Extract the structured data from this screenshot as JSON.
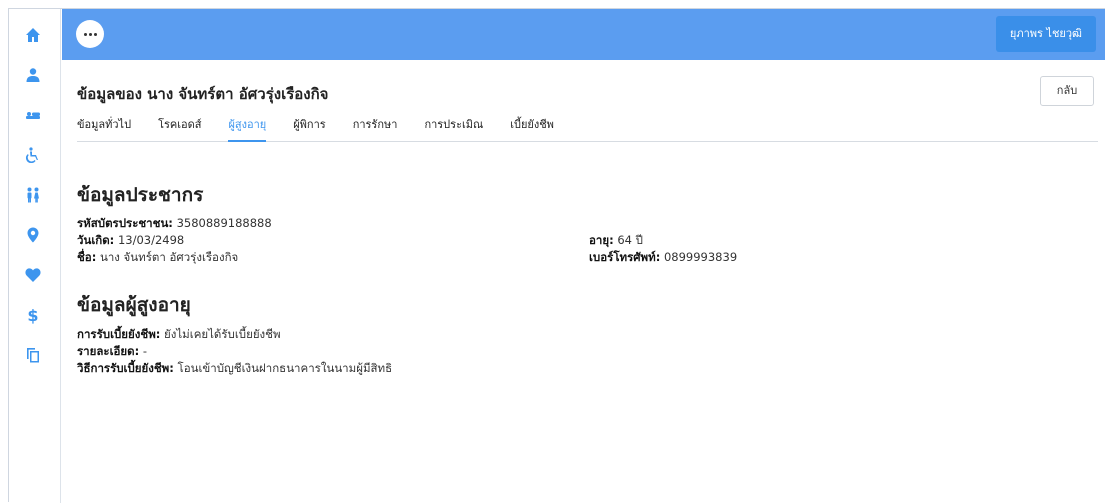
{
  "topbar": {
    "user_label": "ยุภาพร ไชยวุฒิ"
  },
  "sidebar": {
    "icons": [
      "home-icon",
      "person-icon",
      "bed-icon",
      "wheelchair-icon",
      "family-icon",
      "location-icon",
      "heart-icon",
      "dollar-icon",
      "copy-icon"
    ],
    "dollar_glyph": "$"
  },
  "header": {
    "title": "ข้อมูลของ นาง จันทร์ตา อัศวรุ่งเรืองกิจ",
    "back_label": "กลับ"
  },
  "tabs": [
    {
      "label": "ข้อมูลทั่วไป",
      "active": false
    },
    {
      "label": "โรคเอดส์",
      "active": false
    },
    {
      "label": "ผู้สูงอายุ",
      "active": true
    },
    {
      "label": "ผู้พิการ",
      "active": false
    },
    {
      "label": "การรักษา",
      "active": false
    },
    {
      "label": "การประเมิณ",
      "active": false
    },
    {
      "label": "เบี้ยยังชีพ",
      "active": false
    }
  ],
  "population": {
    "title": "ข้อมูลประชากร",
    "id_label": "รหัสบัตรประชาชน:",
    "id_value": "3580889188888",
    "dob_label": "วันเกิด:",
    "dob_value": "13/03/2498",
    "age_label": "อายุ:",
    "age_value": "64 ปี",
    "name_label": "ชื่อ:",
    "name_value": "นาง จันทร์ตา อัศวรุ่งเรืองกิจ",
    "phone_label": "เบอร์โทรศัพท์:",
    "phone_value": "0899993839"
  },
  "elderly": {
    "title": "ข้อมูลผู้สูงอายุ",
    "allowance_label": "การรับเบี้ยยังชีพ:",
    "allowance_value": "ยังไม่เคยได้รับเบี้ยยังชีพ",
    "details_label": "รายละเอียด:",
    "details_value": "-",
    "method_label": "วิธีการรับเบี้ยยังชีพ:",
    "method_value": "โอนเข้าบัญชีเงินฝากธนาคารในนามผู้มีสิทธิ"
  },
  "colors": {
    "topbar": "#5b9df0",
    "accent": "#3d95ee",
    "user_button": "#3a8fe9"
  }
}
